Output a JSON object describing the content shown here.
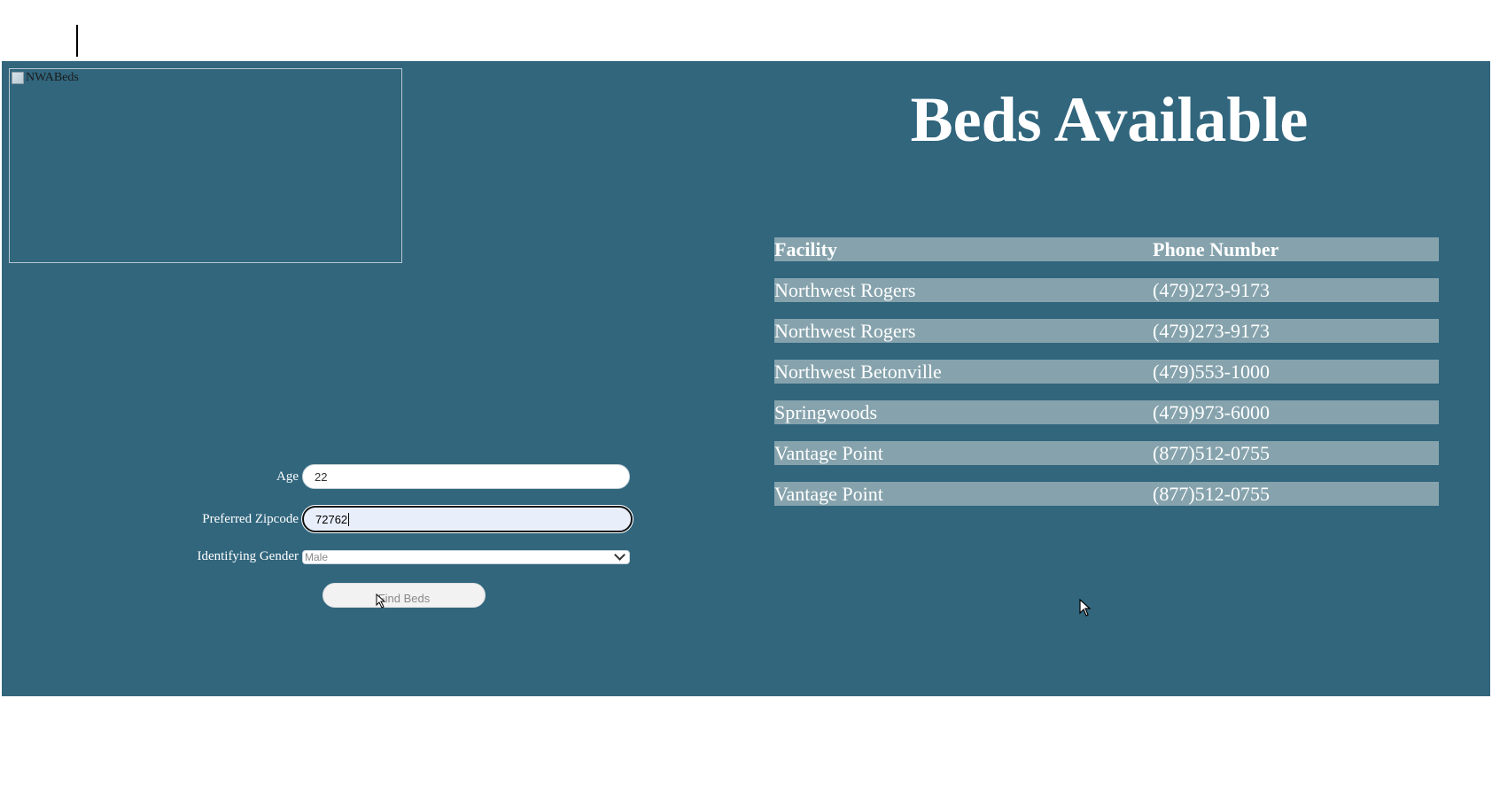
{
  "logo": {
    "alt": "NWABeds"
  },
  "form": {
    "age": {
      "label": "Age",
      "value": "22"
    },
    "zipcode": {
      "label": "Preferred Zipcode",
      "value": "72762"
    },
    "gender": {
      "label": "Identifying Gender",
      "selected": "Male"
    },
    "submit_label": "Find Beds"
  },
  "title": "Beds Available",
  "table": {
    "headers": [
      "Facility",
      "Phone Number"
    ],
    "rows": [
      [
        "Northwest Rogers",
        "(479)273-9173"
      ],
      [
        "Northwest Rogers",
        "(479)273-9173"
      ],
      [
        "Northwest Betonville",
        "(479)553-1000"
      ],
      [
        "Springwoods",
        "(479)973-6000"
      ],
      [
        "Vantage Point",
        "(877)512-0755"
      ],
      [
        "Vantage Point",
        "(877)512-0755"
      ]
    ]
  },
  "colors": {
    "panel_bg": "#31667d",
    "table_row_bg": "#86a3ad",
    "text": "#ffffff"
  }
}
